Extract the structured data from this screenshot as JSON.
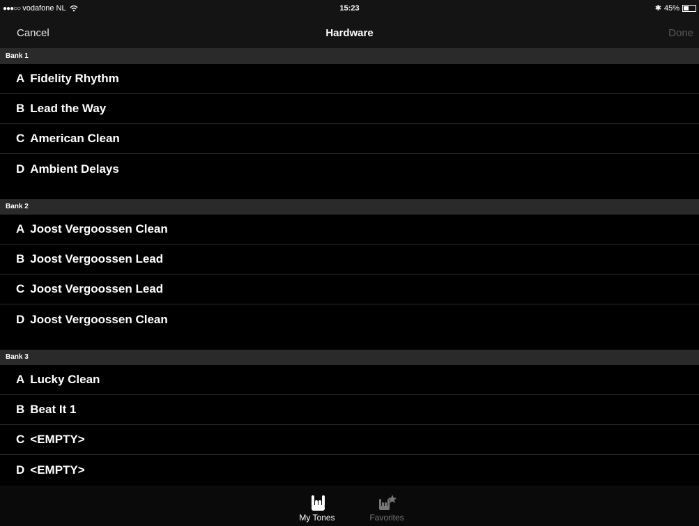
{
  "status": {
    "signal": "●●●○○",
    "carrier": "vodafone NL",
    "time": "15:23",
    "bluetooth": "✱",
    "battery": "45%",
    "battery_level": 0.45
  },
  "nav": {
    "cancel": "Cancel",
    "title": "Hardware",
    "done": "Done"
  },
  "banks": [
    {
      "title": "Bank 1",
      "slots": [
        {
          "slot": "A",
          "name": "Fidelity Rhythm"
        },
        {
          "slot": "B",
          "name": "Lead the Way"
        },
        {
          "slot": "C",
          "name": "American Clean"
        },
        {
          "slot": "D",
          "name": "Ambient Delays"
        }
      ]
    },
    {
      "title": "Bank 2",
      "slots": [
        {
          "slot": "A",
          "name": "Joost Vergoossen Clean"
        },
        {
          "slot": "B",
          "name": "Joost Vergoossen Lead"
        },
        {
          "slot": "C",
          "name": "Joost Vergoossen Lead"
        },
        {
          "slot": "D",
          "name": "Joost Vergoossen Clean"
        }
      ]
    },
    {
      "title": "Bank 3",
      "slots": [
        {
          "slot": "A",
          "name": "Lucky Clean"
        },
        {
          "slot": "B",
          "name": "Beat It 1"
        },
        {
          "slot": "C",
          "name": "<EMPTY>"
        },
        {
          "slot": "D",
          "name": "<EMPTY>"
        }
      ]
    }
  ],
  "tabs": [
    {
      "label": "My Tones",
      "icon": "rock-hand-icon",
      "active": true
    },
    {
      "label": "Favorites",
      "icon": "rock-hand-star-icon",
      "active": false
    }
  ],
  "colors": {
    "background": "#000000",
    "bar": "#141414",
    "section": "#2a2a2a",
    "inactive": "#777777"
  }
}
